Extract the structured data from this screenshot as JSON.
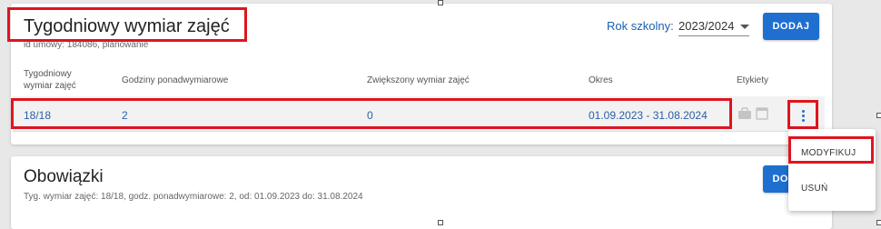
{
  "card1": {
    "title": "Tygodniowy wymiar zajęć",
    "subtitle": "id umowy: 184086, planowanie",
    "year_label": "Rok szkolny:",
    "year_value": "2023/2024",
    "add_button": "DODAJ",
    "columns": [
      "Tygodniowy wymiar zajęć",
      "Godziny ponadwymiarowe",
      "Zwiększony wymiar zajęć",
      "Okres",
      "Etykiety"
    ],
    "row": {
      "weekly": "18/18",
      "overtime": "2",
      "increased": "0",
      "period": "01.09.2023 - 31.08.2024"
    }
  },
  "card2": {
    "title": "Obowiązki",
    "subtitle": "Tyg. wymiar zajęć: 18/18, godz. ponadwymiarowe: 2, od: 01.09.2023 do: 31.08.2024",
    "add_button": "DODAJ"
  },
  "menu": {
    "items": [
      "MODYFIKUJ",
      "USUŃ"
    ]
  },
  "colors": {
    "accent": "#1e6fd0",
    "highlight": "#e0141e",
    "link_text": "#2a5ea8"
  },
  "icons": [
    "briefcase-icon",
    "calendar-icon",
    "more-vert-icon",
    "chevron-down-icon"
  ]
}
